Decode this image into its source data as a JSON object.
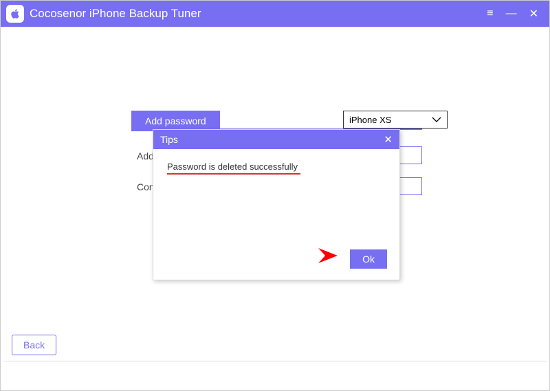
{
  "app": {
    "title": "Cocosenor iPhone Backup Tuner"
  },
  "titlebar": {
    "menu_glyph": "≡",
    "minimize_glyph": "—",
    "close_glyph": "✕"
  },
  "tab": {
    "label": "Add password"
  },
  "device": {
    "selected": "iPhone XS"
  },
  "form": {
    "add_label": "Add pas",
    "confirm_label": "Confirm"
  },
  "dialog": {
    "title": "Tips",
    "close_glyph": "✕",
    "message": "Password is deleted successfully",
    "ok_label": "Ok"
  },
  "footer": {
    "back_label": "Back"
  }
}
